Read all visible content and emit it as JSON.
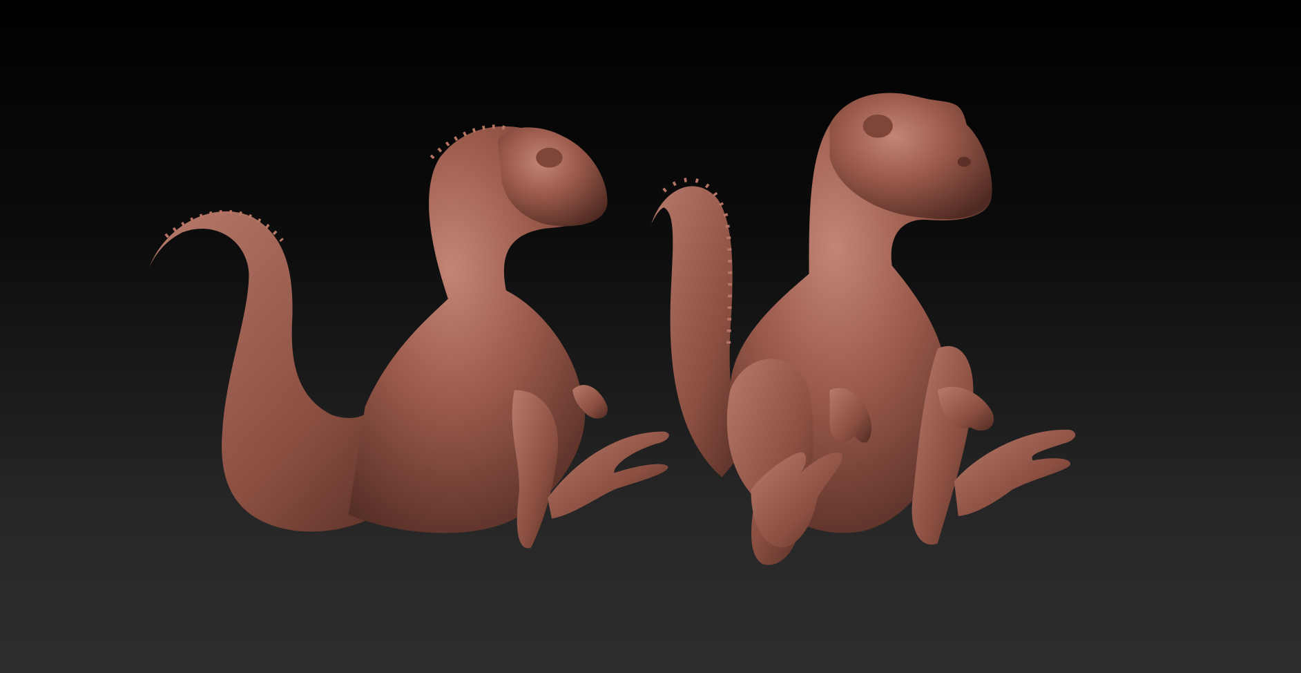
{
  "scene": {
    "background_top": "#000000",
    "background_bottom": "#2e2e2e",
    "model_color": "#9a5a4b",
    "model_highlight": "#c4887a",
    "model_shadow": "#4f2a22"
  }
}
